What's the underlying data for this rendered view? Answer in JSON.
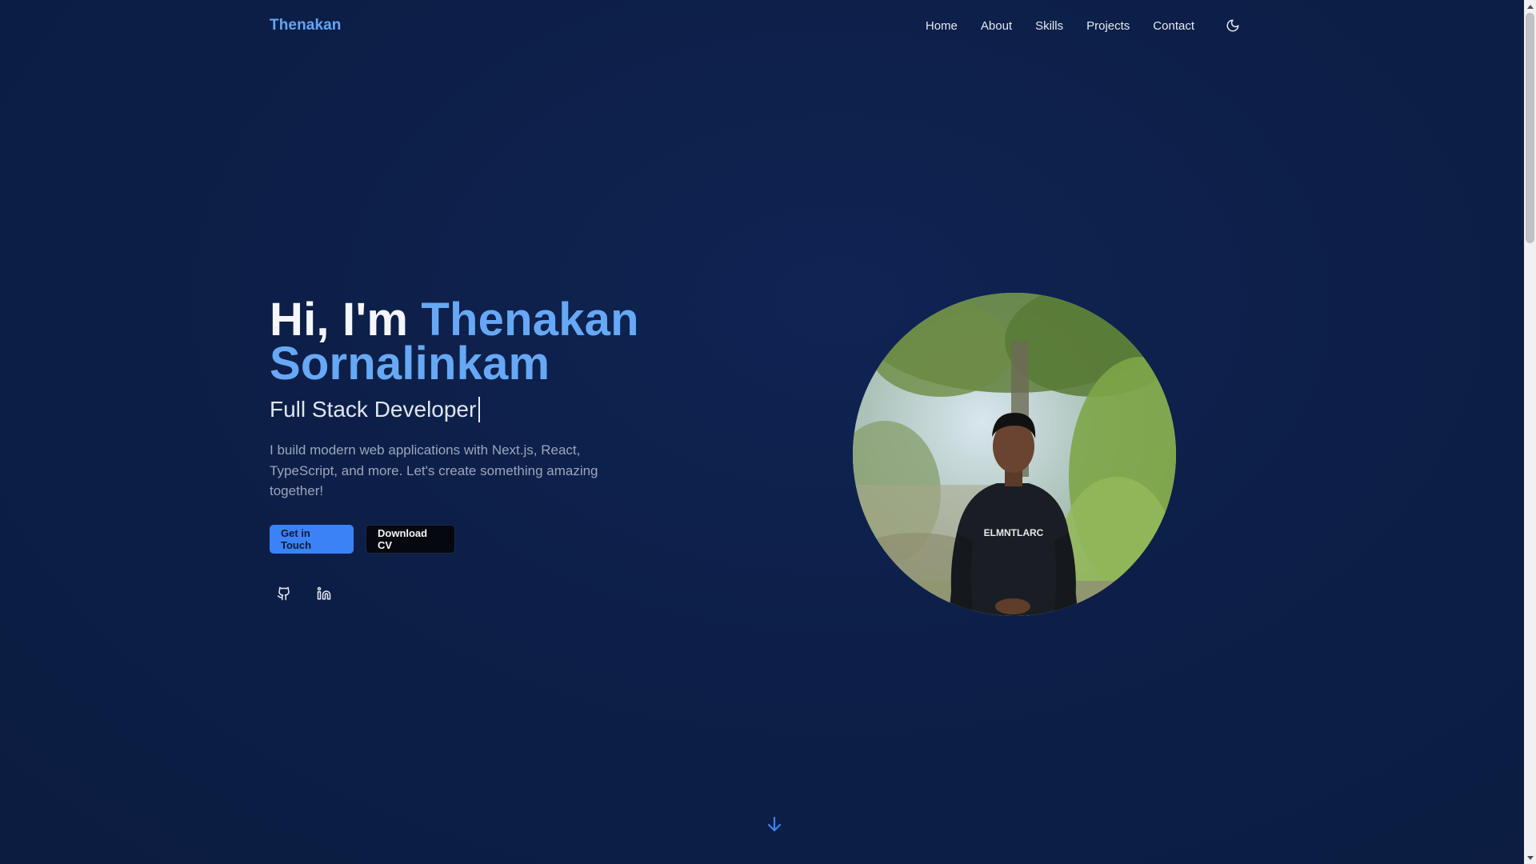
{
  "nav": {
    "brand": "Thenakan",
    "links": [
      "Home",
      "About",
      "Skills",
      "Projects",
      "Contact"
    ],
    "theme_toggle_icon": "moon-icon"
  },
  "hero": {
    "greeting": "Hi, I'm ",
    "name_first": "Thenakan",
    "name_last": "Sornalinkam",
    "subtitle": "Full Stack Developer",
    "description": "I build modern web applications with Next.js, React, TypeScript, and more. Let's create something amazing together!",
    "primary_button": "Get in Touch",
    "secondary_button": "Download CV",
    "social_icons": [
      "github-icon",
      "linkedin-icon"
    ],
    "photo_shirt_text": "ELMNTLARC"
  },
  "scroll_hint_icon": "arrow-down-icon",
  "colors": {
    "background": "#0e1f45",
    "accent": "#3b82f6",
    "name_highlight": "#66a8f5",
    "brand": "#62a6f7"
  }
}
